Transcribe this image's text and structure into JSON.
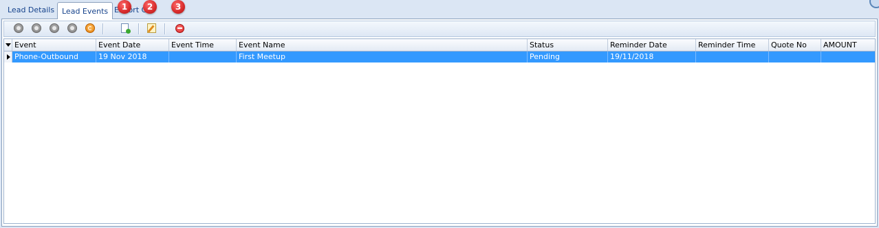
{
  "tabs": [
    {
      "label": "Lead Details"
    },
    {
      "label": "Lead Events",
      "active": true
    },
    {
      "label": "Export G"
    }
  ],
  "badges": [
    "1",
    "2",
    "3"
  ],
  "toolbar": {
    "nav_icons": [
      "first-record-icon",
      "previous-record-icon",
      "next-record-icon",
      "last-record-icon",
      "refresh-icon"
    ],
    "action_icons": [
      "add-document-icon",
      "edit-icon",
      "delete-icon"
    ]
  },
  "grid": {
    "columns": [
      "Event",
      "Event Date",
      "Event Time",
      "Event Name",
      "Status",
      "Reminder Date",
      "Reminder Time",
      "Quote No",
      "AMOUNT"
    ],
    "rows": [
      [
        "Phone-Outbound",
        "19 Nov 2018",
        "",
        "First Meetup",
        "Pending",
        "19/11/2018",
        "",
        "",
        ""
      ]
    ]
  },
  "colors": {
    "selected_row": "#3399ff",
    "background": "#dbe6f4",
    "badge": "#d62a2a"
  }
}
